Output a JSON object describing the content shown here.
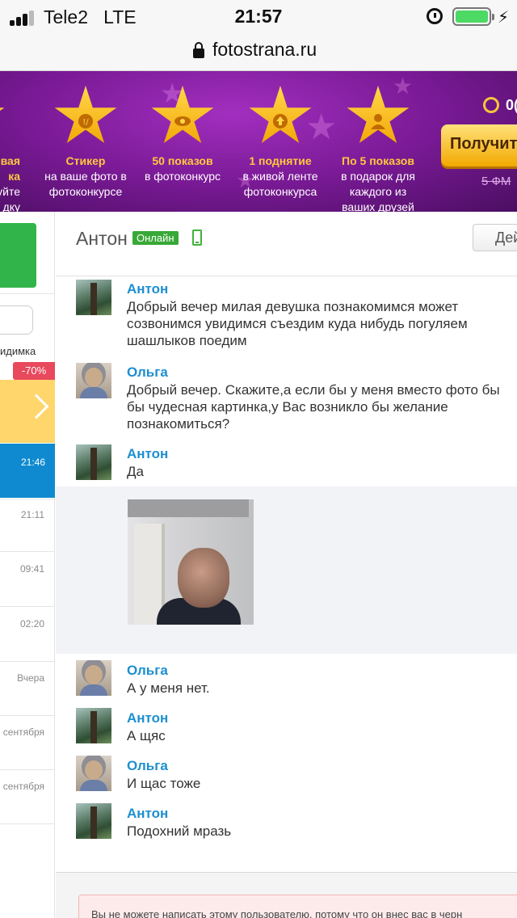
{
  "status_bar": {
    "carrier": "Tele2",
    "network": "LTE",
    "time": "21:57",
    "battery_color": "#4cd964",
    "icons": [
      "signal-icon",
      "alarm-icon",
      "battery-icon",
      "charge-icon"
    ]
  },
  "browser": {
    "url": "fotostrana.ru"
  },
  "promo_banner": {
    "items": [
      {
        "title": "вая",
        "line2": "ка",
        "line3": "уйте",
        "line4": "дку",
        "icon": "partial-star-icon"
      },
      {
        "title": "Стикер",
        "line2": "на ваше фото в",
        "line3": "фотоконкурсе",
        "line4": "",
        "icon": "sticker-icon"
      },
      {
        "title": "50 показов",
        "line2": "в фотоконкурс",
        "line3": "",
        "line4": "",
        "icon": "eye-icon"
      },
      {
        "title": "1 поднятие",
        "line2": "в живой ленте",
        "line3": "фотоконкурса",
        "line4": "",
        "icon": "up-arrow-icon"
      },
      {
        "title": "По 5 показов",
        "line2": "в подарок для",
        "line3": "каждого из",
        "line4": "ваших друзей",
        "icon": "person-icon"
      }
    ],
    "timer_value": "0(",
    "get_button_label": "Получит",
    "old_price": "5 ФМ",
    "accent_color": "#ffc83d"
  },
  "left_column": {
    "invisible_label": "идимка",
    "discount_badge": "-70%",
    "times": [
      "21:46",
      "21:11",
      "09:41",
      "02:20",
      "Вчера",
      "сентября",
      "сентября"
    ],
    "active_color": "#0f8ad0"
  },
  "chat_header": {
    "contact_name": "Антон",
    "online_label": "Онлайн",
    "action_button_label": "Дей"
  },
  "messages": [
    {
      "sender": "Антон",
      "text": "Добрый вечер милая девушка познакомимся может\nсозвонимся увидимся съездим куда нибудь погуляем\nшашлыков поедим"
    },
    {
      "sender": "Ольга",
      "text": "Добрый вечер. Скажите,а если бы у меня вместо фото бы\nбы чудесная картинка,у Вас возникло бы желание\nпознакомиться?"
    },
    {
      "sender": "Антон",
      "text": "Да"
    },
    {
      "sender": "Ольга",
      "text": "А у меня нет."
    },
    {
      "sender": "Антон",
      "text": "А щяс"
    },
    {
      "sender": "Ольга",
      "text": "И щас тоже"
    },
    {
      "sender": "Антон",
      "text": "Подохний мразь"
    }
  ],
  "notice": {
    "text": "Вы не можете написать этому пользователю, потому что он внес вас в черн"
  }
}
